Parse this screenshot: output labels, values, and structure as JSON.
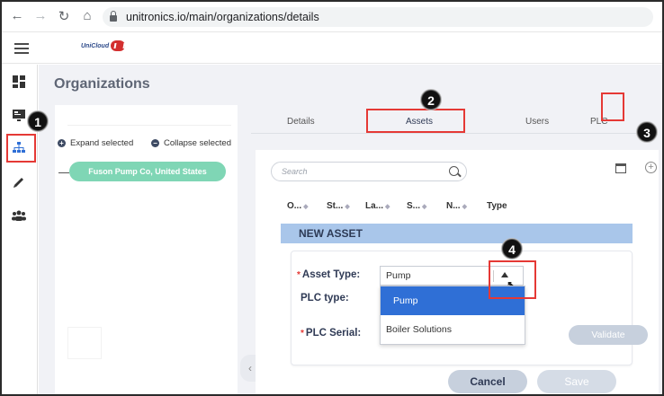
{
  "browser": {
    "url": "unitronics.io/main/organizations/details",
    "back_icon": "back-arrow-icon",
    "forward_icon": "forward-arrow-icon",
    "reload_icon": "reload-icon",
    "home_icon": "home-icon"
  },
  "header": {
    "logo_text": "UniCloud"
  },
  "rail": {
    "items": [
      "dashboard-icon",
      "monitor-icon",
      "org-tree-icon",
      "pencil-icon",
      "users-icon"
    ]
  },
  "page": {
    "title": "Organizations"
  },
  "tree": {
    "expand_label": "Expand selected",
    "collapse_label": "Collapse selected",
    "org_name": "Fuson Pump Co, United States"
  },
  "tabs": {
    "details": "Details",
    "assets": "Assets",
    "users": "Users",
    "plc": "PLC"
  },
  "assets": {
    "search_placeholder": "Search",
    "columns": [
      "O...",
      "St...",
      "La...",
      "S...",
      "N...",
      "Type"
    ],
    "new_asset_title": "NEW ASSET",
    "form": {
      "asset_type_label": "Asset Type:",
      "asset_type_value": "Pump",
      "plc_type_label": "PLC type:",
      "plc_serial_label": "PLC Serial:",
      "options": [
        "Pump",
        "Boiler Solutions"
      ],
      "validate_label": "Validate"
    },
    "cancel_label": "Cancel",
    "save_label": "Save"
  },
  "callouts": [
    "1",
    "2",
    "3",
    "4"
  ],
  "colors": {
    "accent_green": "#7fd6b5",
    "highlight_red": "#e53935",
    "selected_blue": "#2f6fd6",
    "new_asset_bar": "#a9c6ea"
  }
}
